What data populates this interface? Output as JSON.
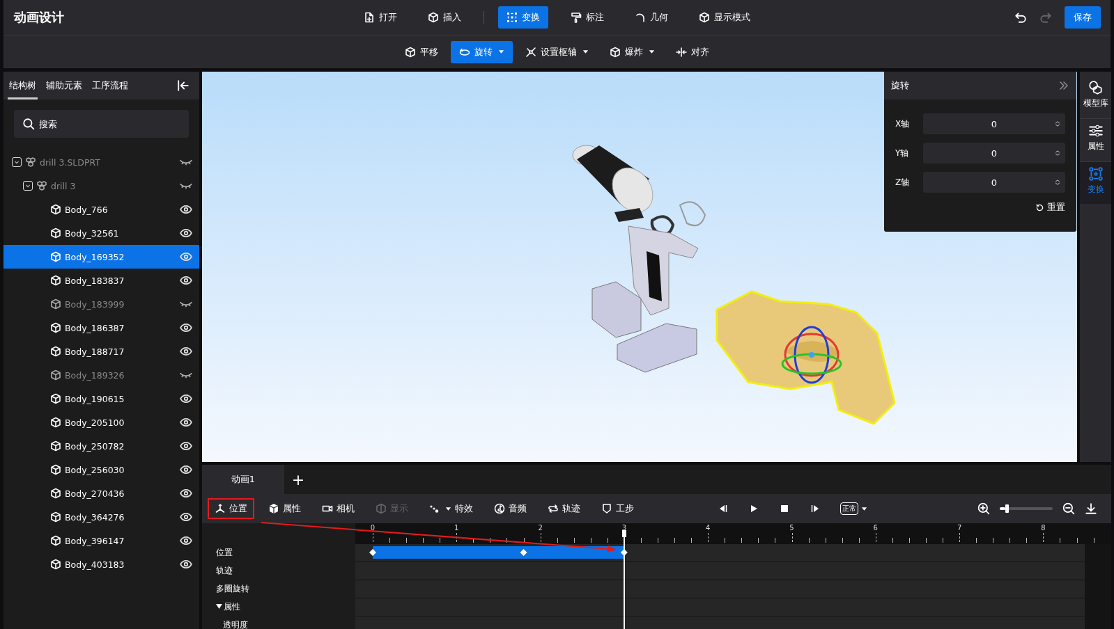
{
  "app": {
    "title": "动画设计"
  },
  "main_toolbar": [
    {
      "label": "打开",
      "selected": false
    },
    {
      "label": "插入",
      "selected": false
    },
    {
      "label": "变换",
      "selected": true
    },
    {
      "label": "标注",
      "selected": false
    },
    {
      "label": "几何",
      "selected": false
    },
    {
      "label": "显示模式",
      "selected": false
    }
  ],
  "history": {
    "undo_disabled": false,
    "redo_disabled": true
  },
  "save_button": "保存",
  "transform_toolbar": [
    {
      "label": "平移",
      "selected": false,
      "dropdown": false
    },
    {
      "label": "旋转",
      "selected": true,
      "dropdown": true
    },
    {
      "label": "设置枢轴",
      "selected": false,
      "dropdown": true
    },
    {
      "label": "爆炸",
      "selected": false,
      "dropdown": true
    },
    {
      "label": "对齐",
      "selected": false,
      "dropdown": false
    }
  ],
  "left_panel": {
    "tabs": [
      {
        "label": "结构树",
        "selected": true
      },
      {
        "label": "辅助元素",
        "selected": false
      },
      {
        "label": "工序流程",
        "selected": false
      }
    ],
    "search": {
      "placeholder": "搜索"
    },
    "tree": [
      {
        "label": "drill 3.SLDPRT",
        "kind": "assembly",
        "visible": false,
        "selected": false,
        "expanded": true,
        "children": [
          {
            "label": "drill 3",
            "kind": "assembly",
            "visible": false,
            "selected": false,
            "expanded": true,
            "children": [
              {
                "label": "Body_766",
                "kind": "body",
                "visible": true,
                "selected": false
              },
              {
                "label": "Body_32561",
                "kind": "body",
                "visible": true,
                "selected": false
              },
              {
                "label": "Body_169352",
                "kind": "body",
                "visible": true,
                "selected": true
              },
              {
                "label": "Body_183837",
                "kind": "body",
                "visible": true,
                "selected": false
              },
              {
                "label": "Body_183999",
                "kind": "body",
                "visible": false,
                "selected": false
              },
              {
                "label": "Body_186387",
                "kind": "body",
                "visible": true,
                "selected": false
              },
              {
                "label": "Body_188717",
                "kind": "body",
                "visible": true,
                "selected": false
              },
              {
                "label": "Body_189326",
                "kind": "body",
                "visible": false,
                "selected": false
              },
              {
                "label": "Body_190615",
                "kind": "body",
                "visible": true,
                "selected": false
              },
              {
                "label": "Body_205100",
                "kind": "body",
                "visible": true,
                "selected": false
              },
              {
                "label": "Body_250782",
                "kind": "body",
                "visible": true,
                "selected": false
              },
              {
                "label": "Body_256030",
                "kind": "body",
                "visible": true,
                "selected": false
              },
              {
                "label": "Body_270436",
                "kind": "body",
                "visible": true,
                "selected": false
              },
              {
                "label": "Body_364276",
                "kind": "body",
                "visible": true,
                "selected": false
              },
              {
                "label": "Body_396147",
                "kind": "body",
                "visible": true,
                "selected": false
              },
              {
                "label": "Body_403183",
                "kind": "body",
                "visible": true,
                "selected": false
              }
            ]
          }
        ]
      }
    ]
  },
  "rotation_panel": {
    "title": "旋转",
    "fields": [
      {
        "label": "X轴",
        "value": "0"
      },
      {
        "label": "Y轴",
        "value": "0"
      },
      {
        "label": "Z轴",
        "value": "0"
      }
    ],
    "reset_button": "重置"
  },
  "right_rail": [
    {
      "label": "模型库",
      "selected": false
    },
    {
      "label": "属性",
      "selected": false
    },
    {
      "label": "变换",
      "selected": true
    }
  ],
  "timeline": {
    "tabs": [
      {
        "label": "动画1",
        "selected": true
      }
    ],
    "add_tab": "+",
    "tools": [
      {
        "label": "位置",
        "disabled": false,
        "highlighted": true,
        "dropdown": false
      },
      {
        "label": "属性",
        "disabled": false,
        "highlighted": false,
        "dropdown": false
      },
      {
        "label": "相机",
        "disabled": false,
        "highlighted": false,
        "dropdown": false
      },
      {
        "label": "显示",
        "disabled": true,
        "highlighted": false,
        "dropdown": false
      },
      {
        "label": "特效",
        "disabled": false,
        "highlighted": false,
        "dropdown": true
      },
      {
        "label": "音频",
        "disabled": false,
        "highlighted": false,
        "dropdown": false
      },
      {
        "label": "轨迹",
        "disabled": false,
        "highlighted": false,
        "dropdown": false
      },
      {
        "label": "工步",
        "disabled": false,
        "highlighted": false,
        "dropdown": false
      }
    ],
    "loop_mode": "正常",
    "zoom_slider": {
      "level": 0.1
    },
    "ruler": [
      "0",
      "1",
      "2",
      "3",
      "4",
      "5",
      "6",
      "7",
      "8"
    ],
    "tracks": [
      {
        "label": "位置"
      },
      {
        "label": "轨迹"
      },
      {
        "label": "多圈旋转"
      },
      {
        "label": "属性",
        "expanded": true,
        "children": [
          {
            "label": "透明度"
          }
        ]
      }
    ]
  }
}
